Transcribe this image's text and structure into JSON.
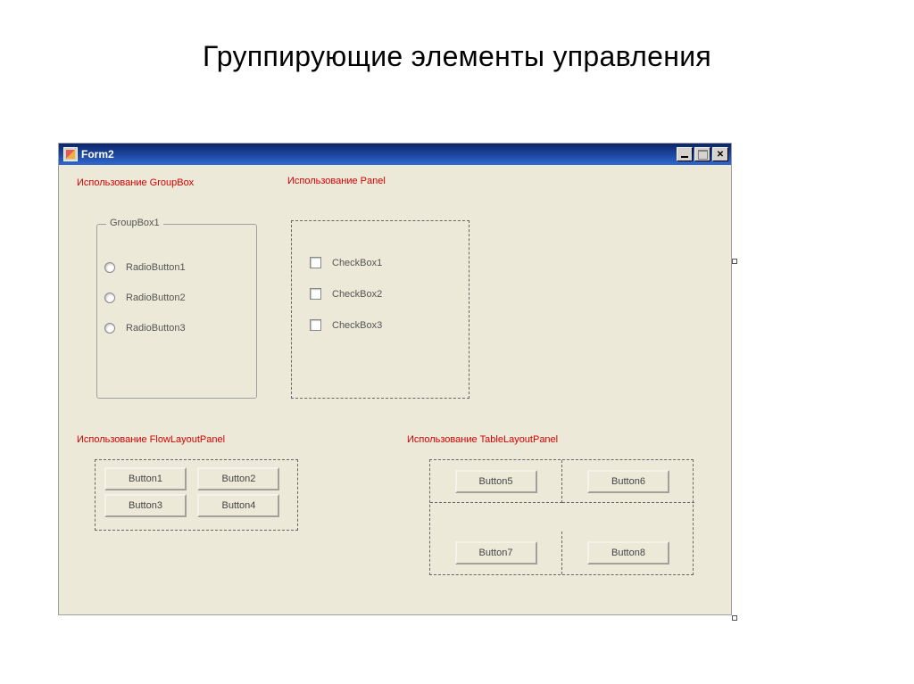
{
  "slide": {
    "title": "Группирующие элементы управления"
  },
  "window": {
    "title": "Form2"
  },
  "labels": {
    "groupbox": "Использование GroupBox",
    "panel": "Использование Panel",
    "flow": "Использование FlowLayoutPanel",
    "table": "Использование TableLayoutPanel"
  },
  "groupbox": {
    "legend": "GroupBox1",
    "radios": [
      "RadioButton1",
      "RadioButton2",
      "RadioButton3"
    ]
  },
  "panel": {
    "checks": [
      "CheckBox1",
      "CheckBox2",
      "CheckBox3"
    ]
  },
  "flow": {
    "buttons": [
      "Button1",
      "Button2",
      "Button3",
      "Button4"
    ]
  },
  "table": {
    "buttons": [
      "Button5",
      "Button6",
      "Button7",
      "Button8"
    ]
  }
}
